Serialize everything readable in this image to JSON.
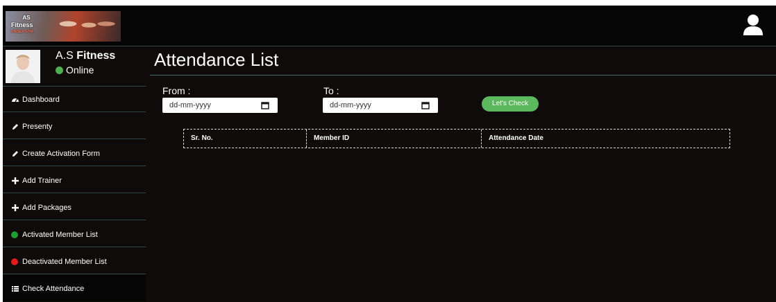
{
  "header": {
    "logo_text": "AS Fitness UNISEX GYM",
    "user_icon": "user-icon"
  },
  "profile": {
    "name_prefix": "A.S",
    "name_bold": "Fitness",
    "status": "Online",
    "status_color": "#4caf50"
  },
  "sidebar": {
    "items": [
      {
        "label": "Dashboard",
        "icon": "dashboard-icon"
      },
      {
        "label": "Presenty",
        "icon": "pencil-icon"
      },
      {
        "label": "Create Activation Form",
        "icon": "pencil-icon"
      },
      {
        "label": "Add Trainer",
        "icon": "plus-icon"
      },
      {
        "label": "Add Packages",
        "icon": "plus-icon"
      },
      {
        "label": "Activated Member List",
        "icon": "green-dot-icon",
        "color": "#1e9e2e"
      },
      {
        "label": "Deactivated Member List",
        "icon": "red-dot-icon",
        "color": "#e8191c"
      },
      {
        "label": "Check Attendance",
        "icon": "list-icon"
      }
    ]
  },
  "main": {
    "title": "Attendance List",
    "from_label": "From :",
    "to_label": "To :",
    "from_value": "dd-mm-yyyy",
    "to_value": "dd-mm-yyyy",
    "check_button": "Let's Check",
    "button_color": "#5cb85c",
    "table_headers": [
      "Sr. No.",
      "Member ID",
      "Attendance Date"
    ]
  }
}
